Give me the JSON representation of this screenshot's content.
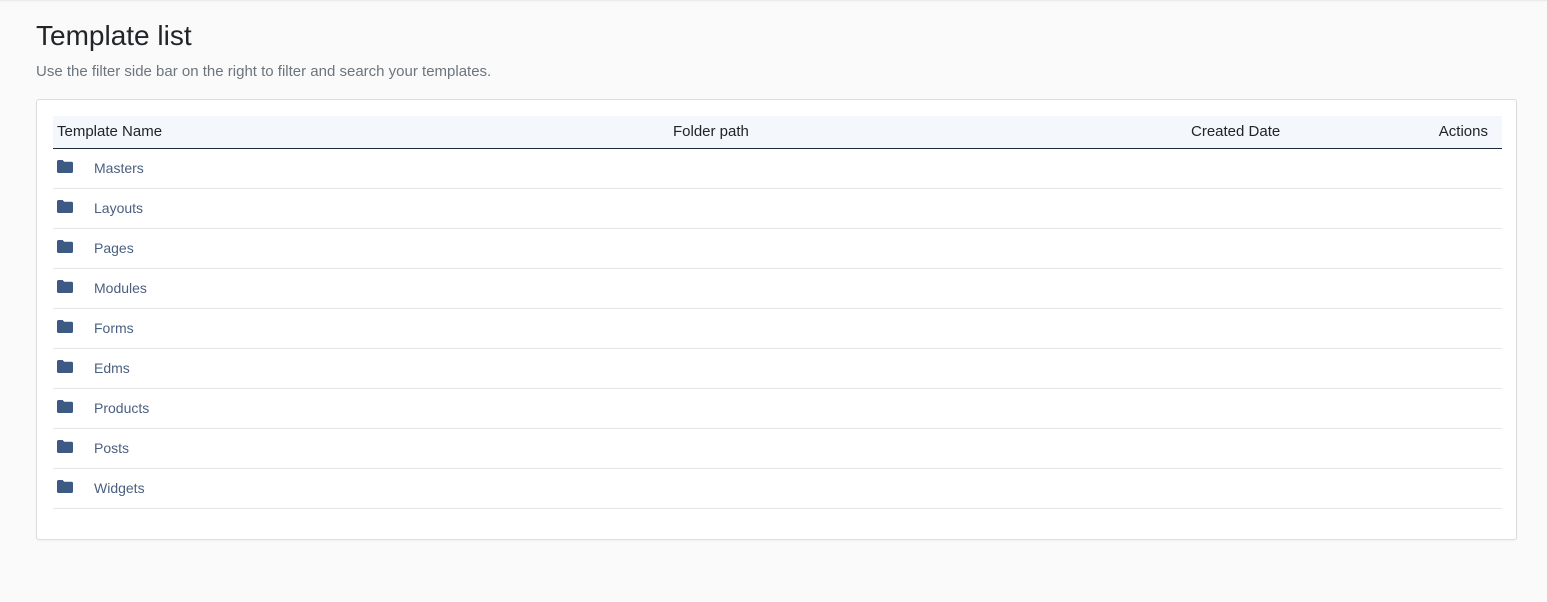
{
  "page": {
    "title": "Template list",
    "subtitle": "Use the filter side bar on the right to filter and search your templates."
  },
  "table": {
    "columns": {
      "name": "Template Name",
      "folder": "Folder path",
      "date": "Created Date",
      "actions": "Actions"
    },
    "rows": [
      {
        "icon": "folder-icon",
        "name": "Masters",
        "folder": "",
        "date": "",
        "actions": ""
      },
      {
        "icon": "folder-icon",
        "name": "Layouts",
        "folder": "",
        "date": "",
        "actions": ""
      },
      {
        "icon": "folder-icon",
        "name": "Pages",
        "folder": "",
        "date": "",
        "actions": ""
      },
      {
        "icon": "folder-icon",
        "name": "Modules",
        "folder": "",
        "date": "",
        "actions": ""
      },
      {
        "icon": "folder-icon",
        "name": "Forms",
        "folder": "",
        "date": "",
        "actions": ""
      },
      {
        "icon": "folder-icon",
        "name": "Edms",
        "folder": "",
        "date": "",
        "actions": ""
      },
      {
        "icon": "folder-icon",
        "name": "Products",
        "folder": "",
        "date": "",
        "actions": ""
      },
      {
        "icon": "folder-icon",
        "name": "Posts",
        "folder": "",
        "date": "",
        "actions": ""
      },
      {
        "icon": "folder-icon",
        "name": "Widgets",
        "folder": "",
        "date": "",
        "actions": ""
      }
    ]
  },
  "colors": {
    "folder_icon": "#3d5a85",
    "row_text": "#4a5f80",
    "header_bg": "#f4f7fc",
    "header_border": "#1f2a3a"
  }
}
